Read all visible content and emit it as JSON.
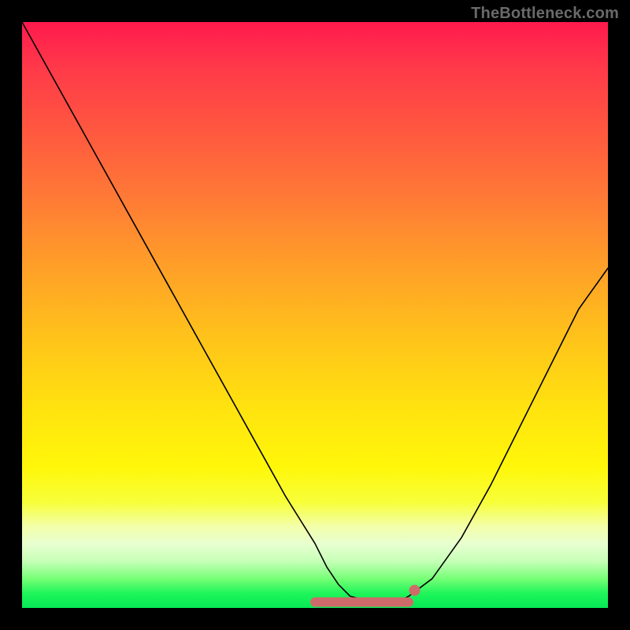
{
  "watermark": "TheBottleneck.com",
  "chart_data": {
    "type": "line",
    "title": "",
    "xlabel": "",
    "ylabel": "",
    "xlim": [
      0,
      100
    ],
    "ylim": [
      0,
      100
    ],
    "grid": false,
    "legend": false,
    "series": [
      {
        "name": "bottleneck-curve",
        "x": [
          0,
          5,
          10,
          15,
          20,
          25,
          30,
          35,
          40,
          45,
          50,
          52,
          54,
          56,
          60,
          64,
          66,
          70,
          75,
          80,
          85,
          90,
          95,
          100
        ],
        "y": [
          100,
          91,
          82,
          73,
          64,
          55,
          46,
          37,
          28,
          19,
          11,
          7,
          4,
          2,
          1,
          1,
          2,
          5,
          12,
          21,
          31,
          41,
          51,
          58
        ]
      }
    ],
    "highlight": {
      "flat_region_x": [
        50,
        66
      ],
      "marker_x": 67,
      "marker_y": 3
    },
    "background_gradient": {
      "direction": "top-to-bottom",
      "stops": [
        {
          "pos": 0.0,
          "color": "#ff1a4d"
        },
        {
          "pos": 0.3,
          "color": "#ff7a36"
        },
        {
          "pos": 0.66,
          "color": "#ffe30f"
        },
        {
          "pos": 0.89,
          "color": "#e8ffd0"
        },
        {
          "pos": 1.0,
          "color": "#06e856"
        }
      ]
    }
  }
}
